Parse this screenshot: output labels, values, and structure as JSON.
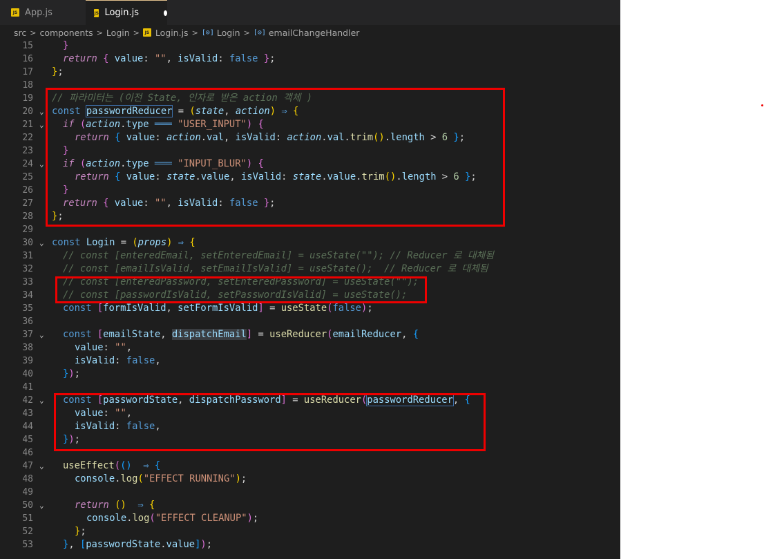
{
  "tabs": [
    {
      "label": "App.js",
      "active": false,
      "badge": "JS"
    },
    {
      "label": "Login.js",
      "active": true,
      "badge": "JS",
      "unsaved": true
    }
  ],
  "breadcrumb": [
    "src",
    "components",
    "Login",
    "Login.js",
    "Login",
    "emailChangeHandler"
  ],
  "code_lines": [
    {
      "n": "15",
      "fold": ""
    },
    {
      "n": "16",
      "fold": ""
    },
    {
      "n": "17",
      "fold": ""
    },
    {
      "n": "18",
      "fold": ""
    },
    {
      "n": "19",
      "fold": ""
    },
    {
      "n": "20",
      "fold": "v"
    },
    {
      "n": "21",
      "fold": "v"
    },
    {
      "n": "22",
      "fold": ""
    },
    {
      "n": "23",
      "fold": ""
    },
    {
      "n": "24",
      "fold": "v"
    },
    {
      "n": "25",
      "fold": ""
    },
    {
      "n": "26",
      "fold": ""
    },
    {
      "n": "27",
      "fold": ""
    },
    {
      "n": "28",
      "fold": ""
    },
    {
      "n": "29",
      "fold": ""
    },
    {
      "n": "30",
      "fold": "v"
    },
    {
      "n": "31",
      "fold": ""
    },
    {
      "n": "32",
      "fold": ""
    },
    {
      "n": "33",
      "fold": ""
    },
    {
      "n": "34",
      "fold": ""
    },
    {
      "n": "35",
      "fold": ""
    },
    {
      "n": "36",
      "fold": ""
    },
    {
      "n": "37",
      "fold": "v"
    },
    {
      "n": "38",
      "fold": ""
    },
    {
      "n": "39",
      "fold": ""
    },
    {
      "n": "40",
      "fold": ""
    },
    {
      "n": "41",
      "fold": ""
    },
    {
      "n": "42",
      "fold": "v"
    },
    {
      "n": "43",
      "fold": ""
    },
    {
      "n": "44",
      "fold": ""
    },
    {
      "n": "45",
      "fold": ""
    },
    {
      "n": "46",
      "fold": ""
    },
    {
      "n": "47",
      "fold": "v"
    },
    {
      "n": "48",
      "fold": ""
    },
    {
      "n": "49",
      "fold": ""
    },
    {
      "n": "50",
      "fold": "v"
    },
    {
      "n": "51",
      "fold": ""
    },
    {
      "n": "52",
      "fold": ""
    },
    {
      "n": "53",
      "fold": ""
    }
  ],
  "text": {
    "zero_args": "() ",
    "l15_brace": "}",
    "l16_return": "return",
    "l16_value": " value",
    "l16_str": "\"\"",
    "l16_isvalid": " isValid",
    "l16_false": "false",
    "l17_close": "}",
    "l19_comment": "// 파라미터는 (이전 State, 인자로 받은 action 객체 )",
    "l20_const": "const ",
    "l20_name": "passwordReducer",
    "l20_eq": " = ",
    "l20_state": "state",
    "l20_action": "action",
    "l20_arrow": " ⇒ ",
    "if": "if ",
    "action": "action",
    "type": "type",
    "eqeq": " ═══ ",
    "l21_str": "\"USER_INPUT\"",
    "l22_val": "val",
    "trim": "trim",
    "length": "length",
    "gt": " > ",
    "six": "6",
    "l24_str": "\"INPUT_BLUR\"",
    "state": "state",
    "value": "value",
    "l30_login": "Login",
    "l30_props": "props",
    "l31_comment": "// const [enteredEmail, setEnteredEmail] = useState(\"\"); // Reducer 로 대체됨",
    "l32_comment": "// const [emailIsValid, setEmailIsValid] = useState();  // Reducer 로 대체됨",
    "l33_comment": "// const [enteredPassword, setEnteredPassword] = useState(\"\");",
    "l34_comment": "// const [passwordIsValid, setPasswordIsValid] = useState();",
    "l35_formvalid": "formIsValid",
    "l35_setform": "setFormIsValid",
    "usestate": "useState",
    "l37_emailstate": "emailState",
    "l37_dispatch": "dispatchEmail",
    "usereducer": "useReducer",
    "l37_emailreducer": "emailReducer",
    "isvalid": "isValid",
    "false": "false",
    "empty_str": "\"\"",
    "l42_pwstate": "passwordState",
    "l42_dispatch": "dispatchPassword",
    "l42_pwreducer": "passwordReducer",
    "useeffect": "useEffect",
    "console": "console",
    "log": "log",
    "l48_str": "\"EFFECT RUNNING\"",
    "return": "return",
    "l51_str": "\"EFFECT CLEANUP\"",
    "l53_pwstate": "passwordState"
  },
  "colors": {
    "editor_bg": "#1e1e1e",
    "annotation": "#e00000",
    "keyword": "#569cd6",
    "control": "#c586c0",
    "string": "#ce9178",
    "comment": "#6a9955"
  }
}
